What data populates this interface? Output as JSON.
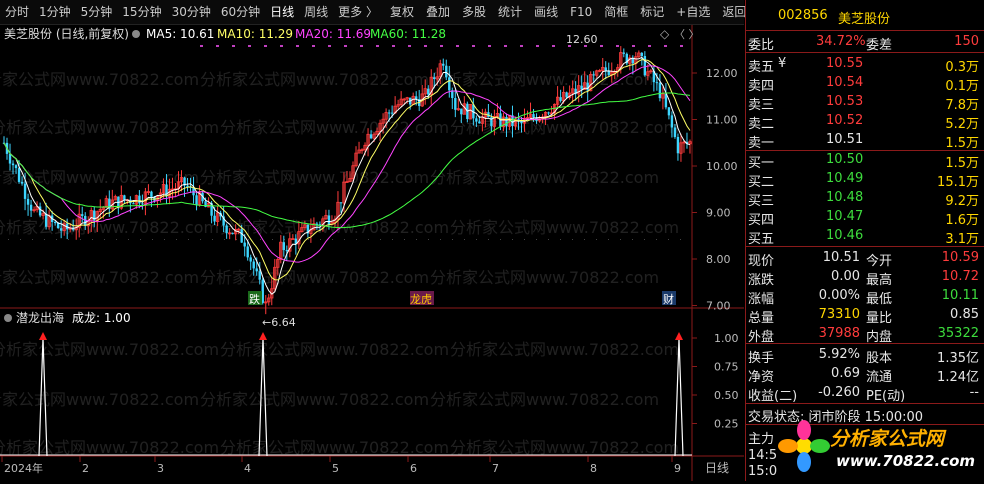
{
  "toolbar": {
    "intervals": [
      "分时",
      "1分钟",
      "5分钟",
      "15分钟",
      "30分钟",
      "60分钟",
      "日线",
      "周线",
      "更多 〉"
    ],
    "actions": [
      "复权",
      "叠加",
      "多股",
      "统计",
      "画线",
      "F10",
      "简框",
      "标记",
      "+自选",
      "返回"
    ]
  },
  "main_chart": {
    "title": "美芝股份 (日线,前复权)",
    "ma5": "MA5: 10.61",
    "ma10": "MA10: 11.29",
    "ma20": "MA20: 11.69",
    "ma60": "MA60: 11.28",
    "yticks": [
      "12.00",
      "11.00",
      "10.00",
      "9.00",
      "8.00",
      "7.00"
    ],
    "high_label": "12.60",
    "low_label": "←6.64",
    "marker_die": "跌",
    "marker_lhb": "龙虎",
    "marker_cai": "财",
    "diamond": "◇",
    "nav": "〈 〉"
  },
  "sub_chart": {
    "title": "潜龙出海",
    "value": "成龙: 1.00",
    "yticks": [
      "1.00",
      "0.75",
      "0.50",
      "0.25"
    ]
  },
  "xaxis": {
    "labels": [
      "2024年",
      "2",
      "3",
      "4",
      "5",
      "6",
      "7",
      "8",
      "9"
    ],
    "period": "日线"
  },
  "chart_data": {
    "type": "line",
    "title": "美芝股份 (日线,前复权)",
    "x": [
      "2024-01",
      "2024-02",
      "2024-03",
      "2024-04",
      "2024-05",
      "2024-06",
      "2024-07",
      "2024-08",
      "2024-09"
    ],
    "ylim": [
      6.5,
      12.8
    ],
    "series": [
      {
        "name": "MA5",
        "color": "#ffffff",
        "values": [
          9.0,
          8.9,
          9.4,
          8.2,
          9.6,
          11.3,
          11.4,
          12.1,
          10.6
        ]
      },
      {
        "name": "MA10",
        "color": "#ffff66",
        "values": [
          9.4,
          9.0,
          9.5,
          8.3,
          9.4,
          11.2,
          11.3,
          12.2,
          11.3
        ]
      },
      {
        "name": "MA20",
        "color": "#ff44ff",
        "values": [
          10.0,
          9.4,
          9.5,
          8.6,
          9.1,
          10.8,
          11.0,
          11.9,
          11.7
        ]
      },
      {
        "name": "MA60",
        "color": "#44ff44",
        "values": [
          10.0,
          9.5,
          9.5,
          9.2,
          9.0,
          9.6,
          10.5,
          11.3,
          11.3
        ]
      }
    ],
    "annotations": [
      {
        "label": "12.60",
        "value": 12.6
      },
      {
        "label": "6.64",
        "value": 6.64
      }
    ],
    "signal_series": {
      "name": "成龙",
      "values_at": [
        "2024-01",
        "2024-04",
        "2024-09"
      ],
      "value": 1.0
    }
  },
  "watermark": "分析家公式网www.70822.com",
  "quote": {
    "code": "002856",
    "name": "美芝股份",
    "weibi_label": "委比",
    "weibi": "34.72%",
    "weicha_label": "委差",
    "weicha": "150",
    "asks": [
      {
        "label": "卖五",
        "flag": "¥",
        "price": "10.55",
        "vol": "0.3万"
      },
      {
        "label": "卖四",
        "flag": "",
        "price": "10.54",
        "vol": "0.1万"
      },
      {
        "label": "卖三",
        "flag": "",
        "price": "10.53",
        "vol": "7.8万"
      },
      {
        "label": "卖二",
        "flag": "",
        "price": "10.52",
        "vol": "5.2万"
      },
      {
        "label": "卖一",
        "flag": "",
        "price": "10.51",
        "vol": "1.5万"
      }
    ],
    "bids": [
      {
        "label": "买一",
        "price": "10.50",
        "vol": "1.5万"
      },
      {
        "label": "买二",
        "price": "10.49",
        "vol": "15.1万"
      },
      {
        "label": "买三",
        "price": "10.48",
        "vol": "9.2万"
      },
      {
        "label": "买四",
        "price": "10.47",
        "vol": "1.6万"
      },
      {
        "label": "买五",
        "price": "10.46",
        "vol": "3.1万"
      }
    ],
    "stats": [
      {
        "l1": "现价",
        "v1": "10.51",
        "c1": "white",
        "l2": "今开",
        "v2": "10.59",
        "c2": "red"
      },
      {
        "l1": "涨跌",
        "v1": "0.00",
        "c1": "white",
        "l2": "最高",
        "v2": "10.72",
        "c2": "red"
      },
      {
        "l1": "涨幅",
        "v1": "0.00%",
        "c1": "white",
        "l2": "最低",
        "v2": "10.11",
        "c2": "green"
      },
      {
        "l1": "总量",
        "v1": "73310",
        "c1": "yellow",
        "l2": "量比",
        "v2": "0.85",
        "c2": "white"
      },
      {
        "l1": "外盘",
        "v1": "37988",
        "c1": "red",
        "l2": "内盘",
        "v2": "35322",
        "c2": "green"
      }
    ],
    "stats2": [
      {
        "l1": "换手",
        "v1": "5.92%",
        "l2": "股本",
        "v2": "1.35亿"
      },
      {
        "l1": "净资",
        "v1": "0.69",
        "l2": "流通",
        "v2": "1.24亿"
      },
      {
        "l1": "收益(二)",
        "v1": "-0.260",
        "l2": "PE(动)",
        "v2": "--"
      }
    ],
    "status": "交易状态: 闭市阶段 15:00:00",
    "zhuli": "主力",
    "time1": "14:5",
    "time2": "15:0"
  },
  "logo": {
    "text": "分析家公式网",
    "url": "www.70822.com"
  }
}
